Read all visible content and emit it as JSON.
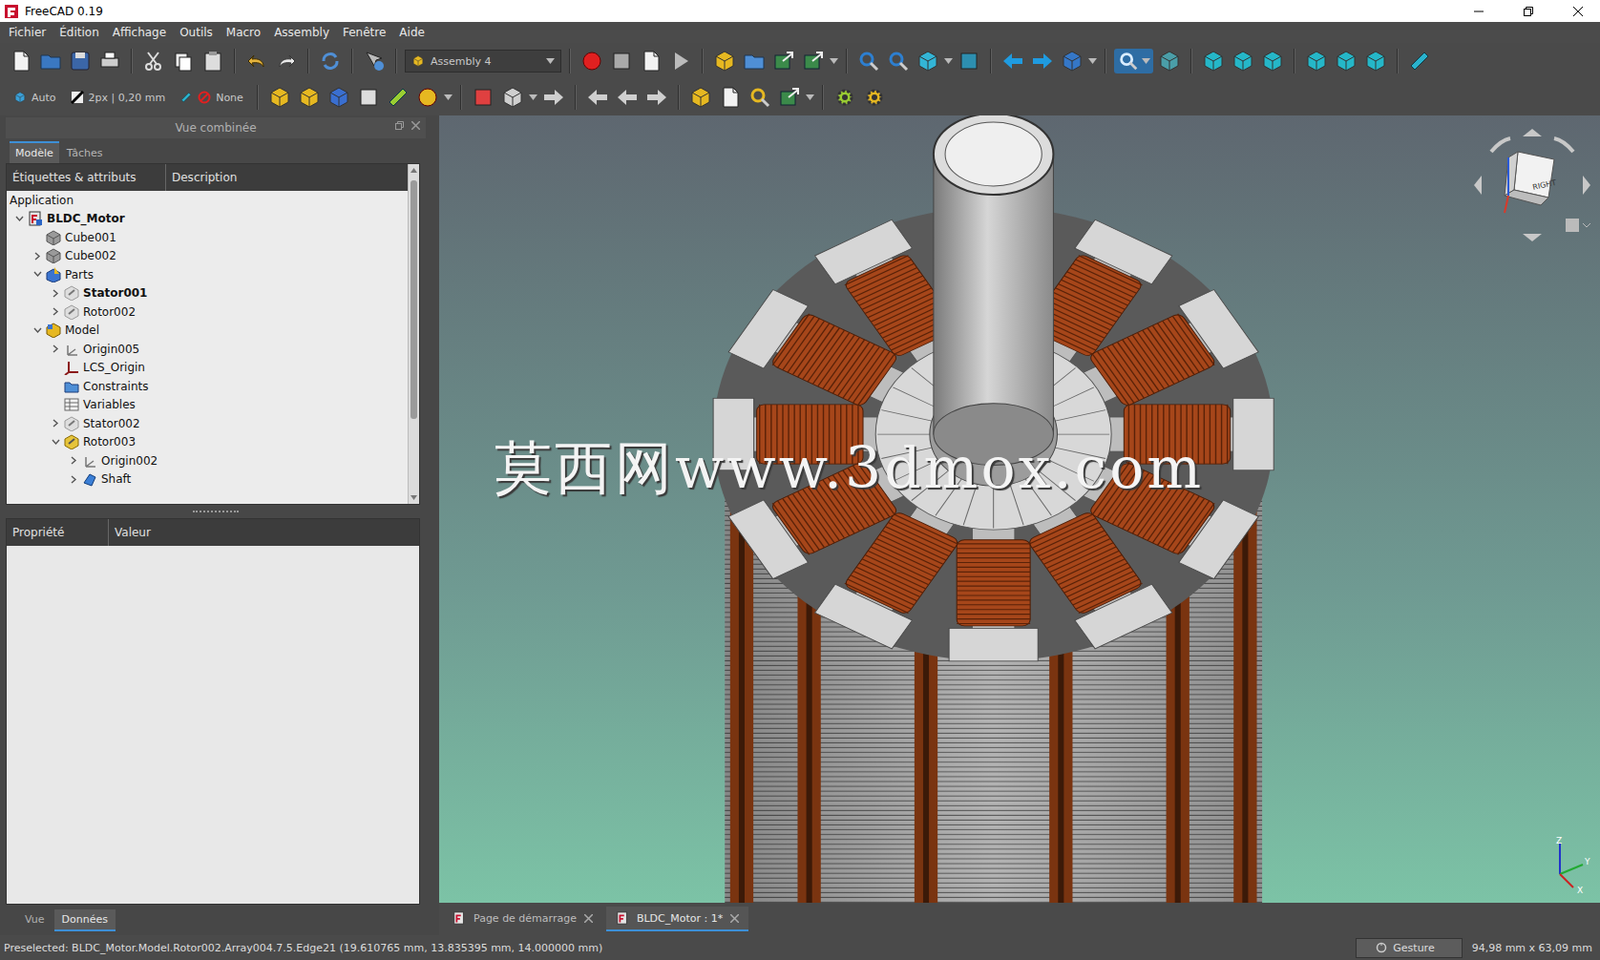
{
  "window": {
    "title": "FreeCAD 0.19"
  },
  "menu": [
    "Fichier",
    "Édition",
    "Affichage",
    "Outils",
    "Macro",
    "Assembly",
    "Fenêtre",
    "Aide"
  ],
  "toolbar": {
    "workbench": "Assembly 4",
    "draw_style": "Auto",
    "line_width": "2px | 0,20 mm",
    "selection_style": "None"
  },
  "combo_view": {
    "title": "Vue combinée",
    "tabs": [
      {
        "label": "Modèle",
        "selected": true
      },
      {
        "label": "Tâches",
        "selected": false
      }
    ],
    "tree": {
      "columns": [
        "Étiquettes & attributs",
        "Description"
      ],
      "items": [
        {
          "label": "Application",
          "depth": 0,
          "kind": "root",
          "expandable": false,
          "expanded": false,
          "active": false
        },
        {
          "label": "BLDC_Motor",
          "depth": 0,
          "kind": "document",
          "expandable": true,
          "expanded": true,
          "active": true
        },
        {
          "label": "Cube001",
          "depth": 1,
          "kind": "solid",
          "expandable": false,
          "expanded": false,
          "active": false
        },
        {
          "label": "Cube002",
          "depth": 1,
          "kind": "solid",
          "expandable": true,
          "expanded": false,
          "active": false
        },
        {
          "label": "Parts",
          "depth": 1,
          "kind": "part",
          "expandable": true,
          "expanded": true,
          "active": false
        },
        {
          "label": "Stator001",
          "depth": 2,
          "kind": "link",
          "expandable": true,
          "expanded": false,
          "active": true
        },
        {
          "label": "Rotor002",
          "depth": 2,
          "kind": "link",
          "expandable": true,
          "expanded": false,
          "active": false
        },
        {
          "label": "Model",
          "depth": 1,
          "kind": "assembly",
          "expandable": true,
          "expanded": true,
          "active": false
        },
        {
          "label": "Origin005",
          "depth": 2,
          "kind": "origin",
          "expandable": true,
          "expanded": false,
          "active": false
        },
        {
          "label": "LCS_Origin",
          "depth": 2,
          "kind": "lcs",
          "expandable": false,
          "expanded": false,
          "active": false
        },
        {
          "label": "Constraints",
          "depth": 2,
          "kind": "folder",
          "expandable": false,
          "expanded": false,
          "active": false
        },
        {
          "label": "Variables",
          "depth": 2,
          "kind": "table",
          "expandable": false,
          "expanded": false,
          "active": false
        },
        {
          "label": "Stator002",
          "depth": 2,
          "kind": "link",
          "expandable": true,
          "expanded": false,
          "active": false
        },
        {
          "label": "Rotor003",
          "depth": 2,
          "kind": "link_variant",
          "expandable": true,
          "expanded": true,
          "active": false
        },
        {
          "label": "Origin002",
          "depth": 3,
          "kind": "origin",
          "expandable": true,
          "expanded": false,
          "active": false
        },
        {
          "label": "Shaft",
          "depth": 3,
          "kind": "body",
          "expandable": true,
          "expanded": false,
          "active": false
        }
      ]
    },
    "properties": {
      "columns": [
        "Propriété",
        "Valeur"
      ]
    },
    "bottom_tabs": [
      {
        "label": "Vue",
        "selected": false
      },
      {
        "label": "Données",
        "selected": true
      }
    ]
  },
  "viewport": {
    "watermark": "莫西网www.3dmox.com",
    "navcube_label": "RIGHT",
    "axes": [
      "Z",
      "Y",
      "X"
    ]
  },
  "doc_tabs": [
    {
      "label": "Page de démarrage",
      "selected": false
    },
    {
      "label": "BLDC_Motor : 1*",
      "selected": true
    }
  ],
  "status_bar": {
    "message": "Preselected: BLDC_Motor.Model.Rotor002.Array004.7.5.Edge21 (19.610765 mm, 13.835395 mm, 14.000000 mm)",
    "nav_style": "Gesture",
    "dimensions": "94,98 mm x 63,09 mm"
  }
}
